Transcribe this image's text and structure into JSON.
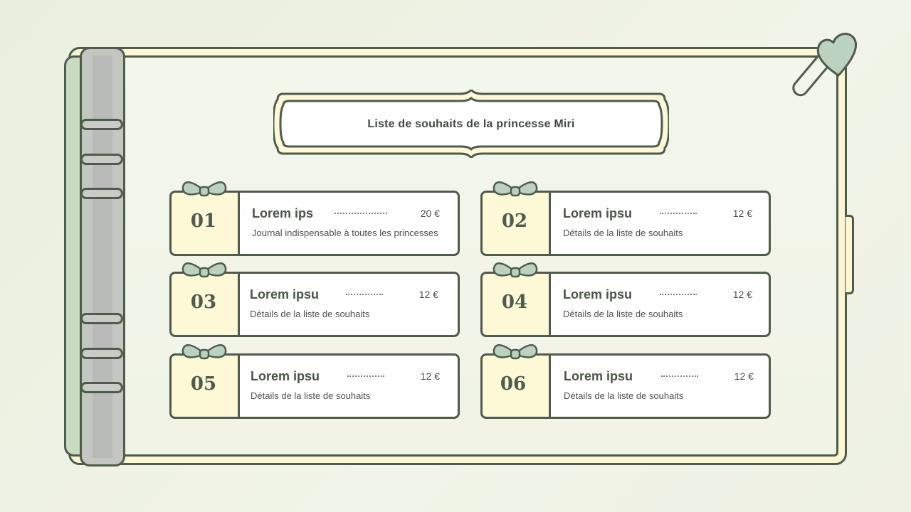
{
  "title": "Liste de souhaits de la princesse Miri",
  "colors": {
    "outline": "#4f5b4d",
    "page": "#f2f5ea",
    "cream": "#fdf9d6",
    "green": "#c9dcc2",
    "bow": "#bcd2c0"
  },
  "items": [
    {
      "number": "01",
      "title": "Lorem ips",
      "price": "20 €",
      "description": "Journal indispensable à toutes les princesses"
    },
    {
      "number": "02",
      "title": "Lorem ipsu",
      "price": "12 €",
      "description": "Détails de la liste de souhaits"
    },
    {
      "number": "03",
      "title": "Lorem ipsu",
      "price": "12 €",
      "description": "Détails de la liste de souhaits"
    },
    {
      "number": "04",
      "title": "Lorem ipsu",
      "price": "12 €",
      "description": "Détails de la liste de souhaits"
    },
    {
      "number": "05",
      "title": "Lorem ipsu",
      "price": "12 €",
      "description": "Détails de la liste de souhaits"
    },
    {
      "number": "06",
      "title": "Lorem ipsu",
      "price": "12 €",
      "description": "Détails de la liste de souhaits"
    }
  ],
  "icons": [
    "heart-clip-icon",
    "bow-icon",
    "binder-ring-icon"
  ]
}
